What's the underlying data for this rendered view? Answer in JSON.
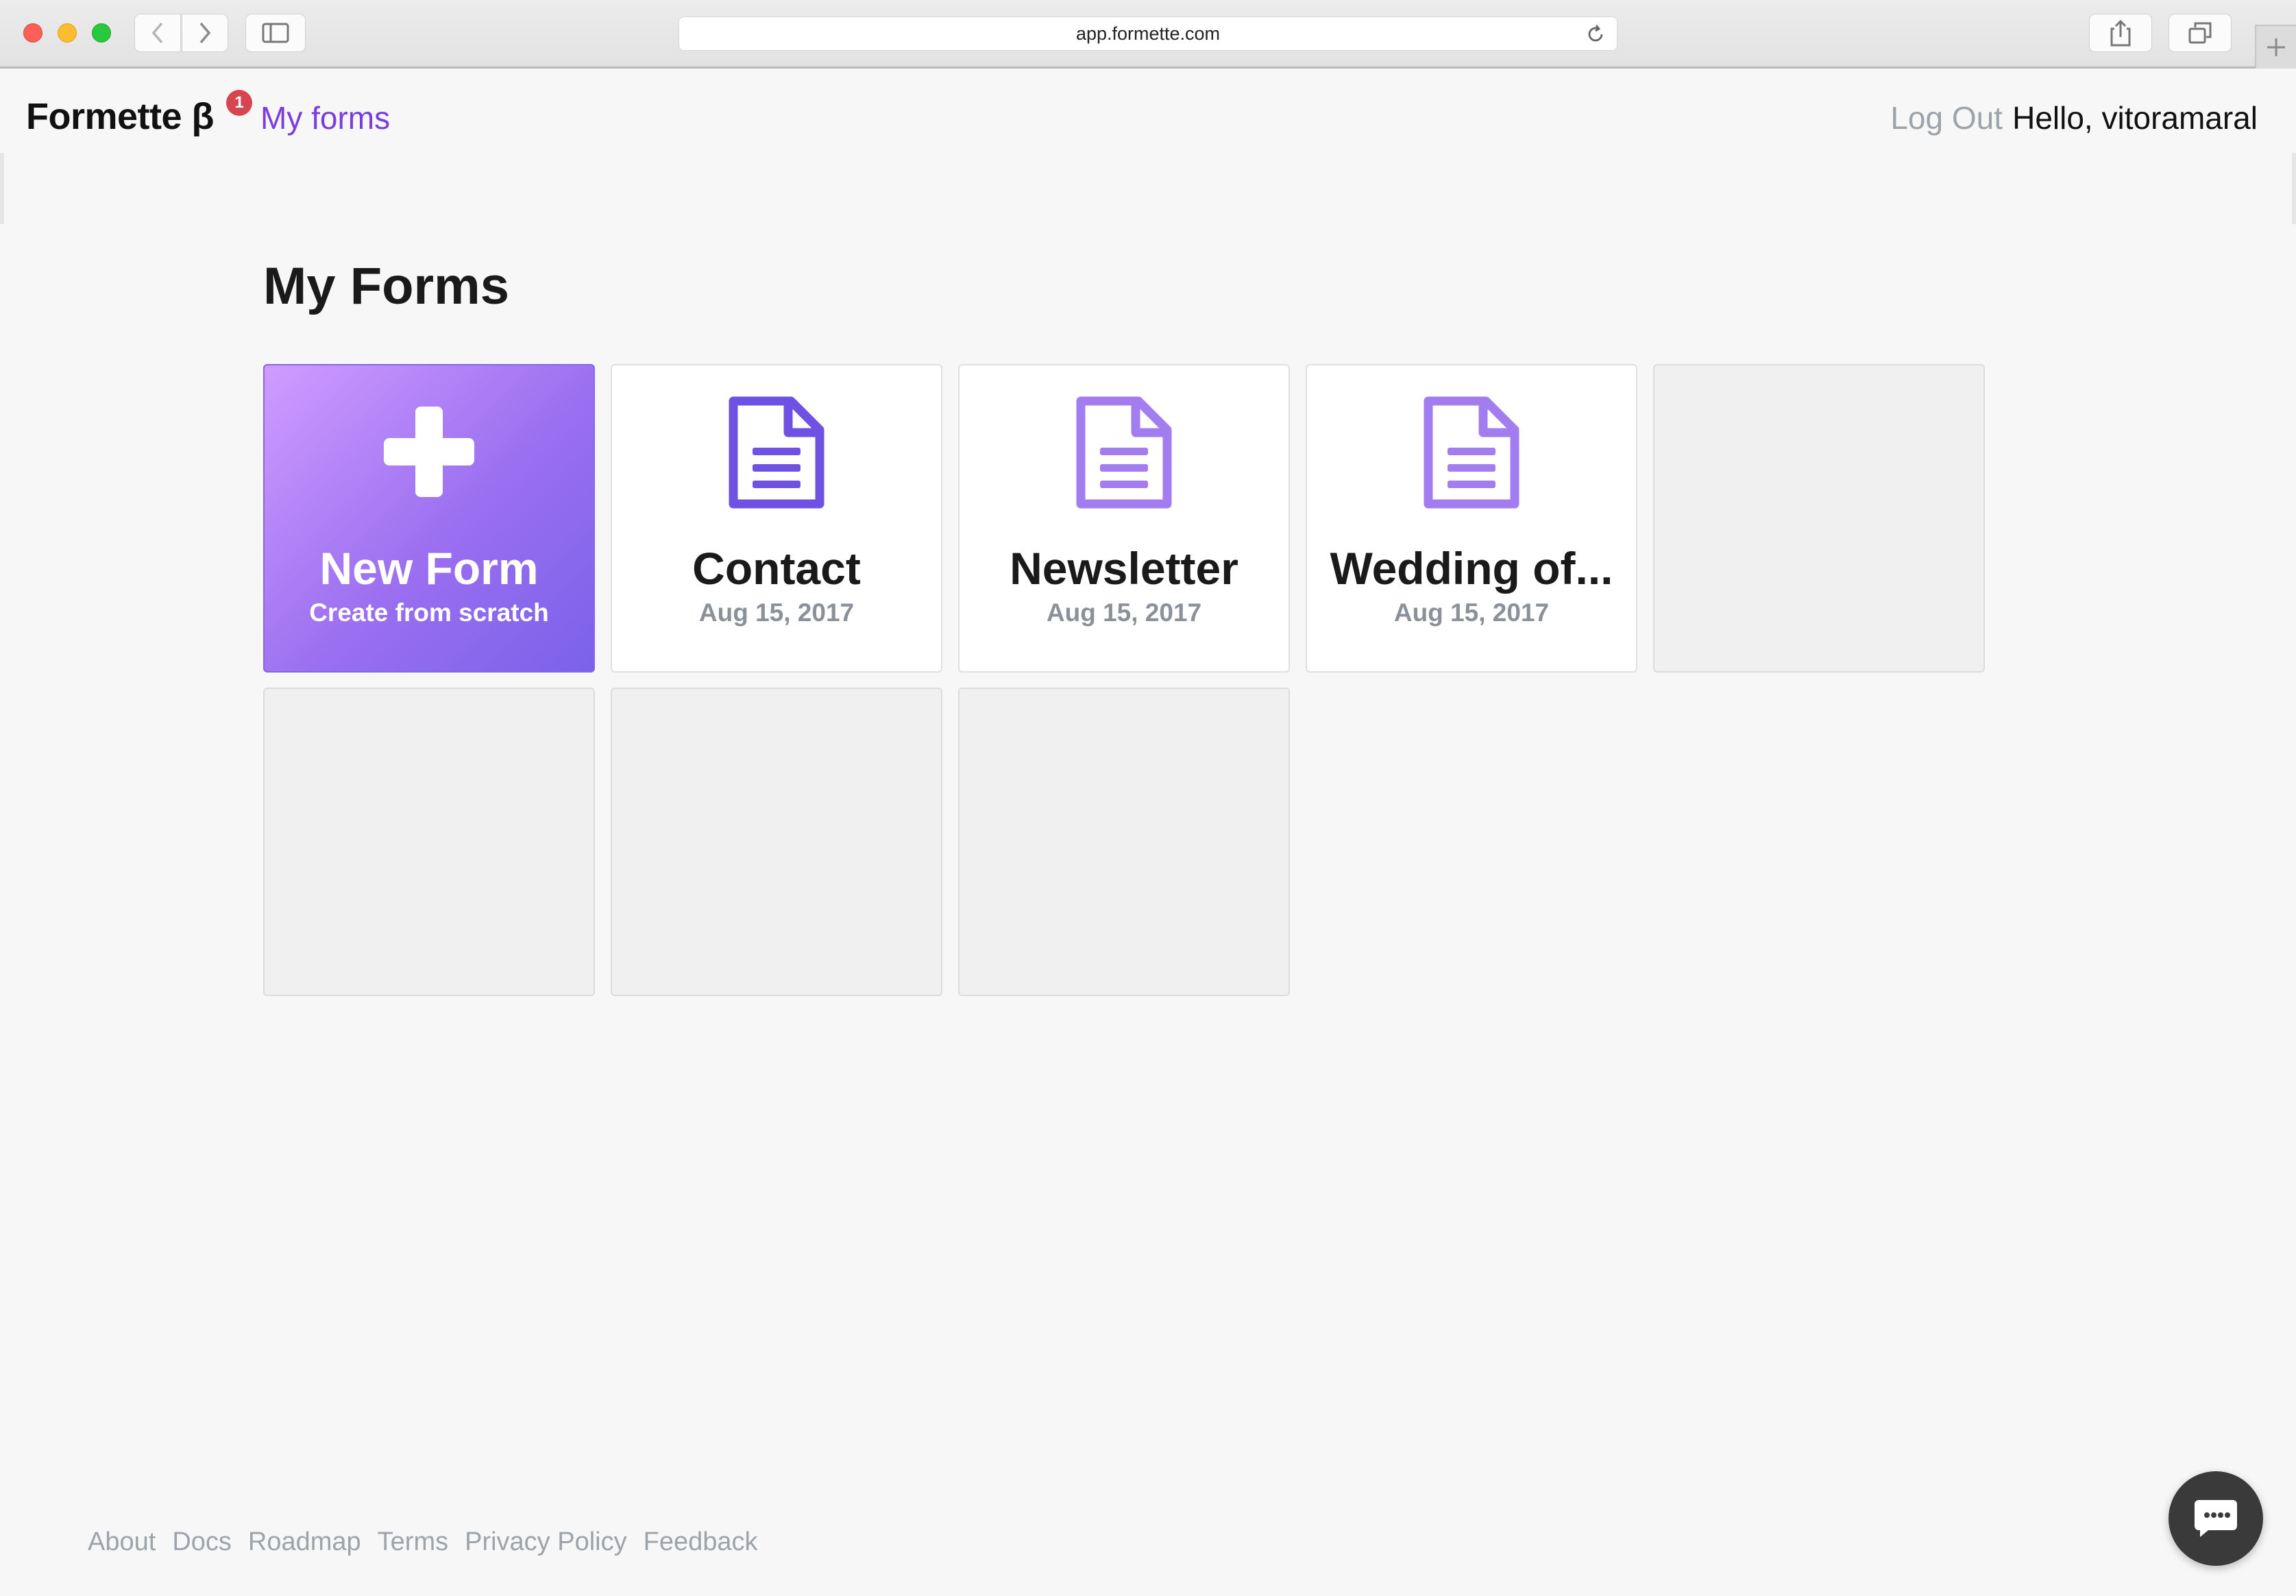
{
  "browser": {
    "url": "app.formette.com",
    "icons": {
      "back": "chevron-left-icon",
      "forward": "chevron-right-icon",
      "sidebar": "sidebar-icon",
      "reload": "reload-icon",
      "share": "share-icon",
      "tabs": "tabs-icon",
      "new_tab": "plus-icon"
    }
  },
  "header": {
    "brand": "Formette β",
    "badge_count": "1",
    "nav_link": "My forms",
    "logout": "Log Out",
    "greeting": "Hello, vitoramaral"
  },
  "main": {
    "title": "My Forms",
    "new_form": {
      "title": "New Form",
      "subtitle": "Create from scratch",
      "icon": "plus-icon"
    },
    "forms": [
      {
        "title": "Contact",
        "date": "Aug 15, 2017",
        "icon": "document-icon",
        "icon_color": "#6f52e4"
      },
      {
        "title": "Newsletter",
        "date": "Aug 15, 2017",
        "icon": "document-icon",
        "icon_color": "#a27df0"
      },
      {
        "title": "Wedding of...",
        "date": "Aug 15, 2017",
        "icon": "document-icon",
        "icon_color": "#a27df0"
      }
    ],
    "empty_slots": 4
  },
  "footer": {
    "links": [
      "About",
      "Docs",
      "Roadmap",
      "Terms",
      "Privacy Policy",
      "Feedback"
    ]
  },
  "chat": {
    "icon": "chat-icon"
  },
  "colors": {
    "accent": "#7a3ee0",
    "badge": "#d64550",
    "new_form_gradient_start": "#cf9cff",
    "new_form_gradient_end": "#7a62ea"
  }
}
